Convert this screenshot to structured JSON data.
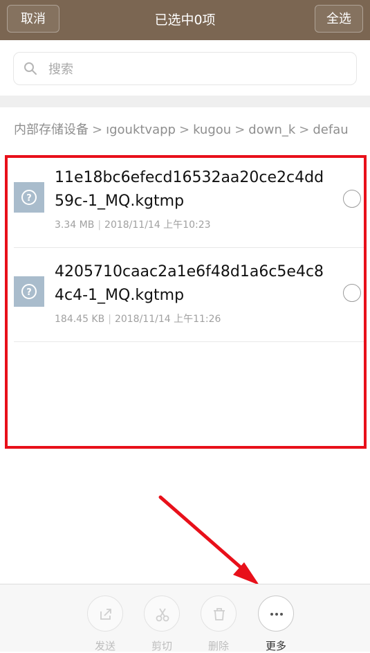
{
  "header": {
    "cancel_label": "取消",
    "title": "已选中0项",
    "select_all_label": "全选",
    "background_color": "#7b6652"
  },
  "search": {
    "placeholder": "搜索",
    "icon": "search-icon"
  },
  "breadcrumb": [
    "内部存储设备",
    "ıgouktvapp",
    "kugou",
    "down_k",
    "defau"
  ],
  "files": [
    {
      "name": "11e18bc6efecd16532aa20ce2c4dd59c-1_MQ.kgtmp",
      "size": "3.34 MB",
      "date": "2018/11/14 上午10:23",
      "icon": "unknown-file-icon",
      "selected": false
    },
    {
      "name": "4205710caac2a1e6f48d1a6c5e4c84c4-1_MQ.kgtmp",
      "size": "184.45 KB",
      "date": "2018/11/14 上午11:26",
      "icon": "unknown-file-icon",
      "selected": false
    }
  ],
  "toolbar": {
    "send_label": "发送",
    "cut_label": "剪切",
    "delete_label": "删除",
    "more_label": "更多"
  },
  "annotation": {
    "highlight_color": "#e8101a"
  }
}
